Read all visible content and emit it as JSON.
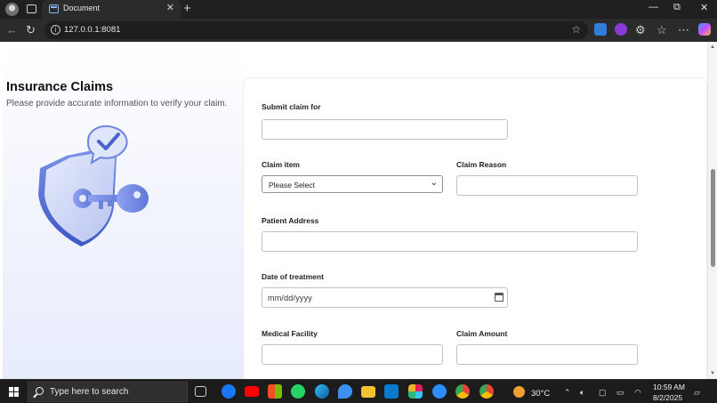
{
  "browser": {
    "tab_title": "Document",
    "tab_close": "✕",
    "new_tab": "+",
    "url": "127.0.0.1:8081",
    "window_controls": [
      "—",
      "⧉",
      "✕"
    ]
  },
  "page": {
    "heading": "Insurance Claims",
    "subtitle": "Please provide accurate information to verify your claim.",
    "illustration": "shield-key-check-icon"
  },
  "form": {
    "submit_claim_for_label": "Submit claim for",
    "claim_item_label": "Claim item",
    "claim_item_selected": "Please Select",
    "claim_reason_label": "Claim Reason",
    "patient_address_label": "Patient Address",
    "date_of_treatment_label": "Date of treatment",
    "date_placeholder": "mm/dd/yyyy",
    "medical_facility_label": "Medical Facility",
    "claim_amount_label": "Claim Amount"
  },
  "taskbar": {
    "search_placeholder": "Type here to search",
    "temperature": "30°C",
    "time": "10:59 AM",
    "date": "8/2/2025"
  },
  "colors": {
    "accent": "#5b74d8",
    "illustration_light": "#c9d2f5",
    "illustration_dark": "#4a63cc"
  }
}
